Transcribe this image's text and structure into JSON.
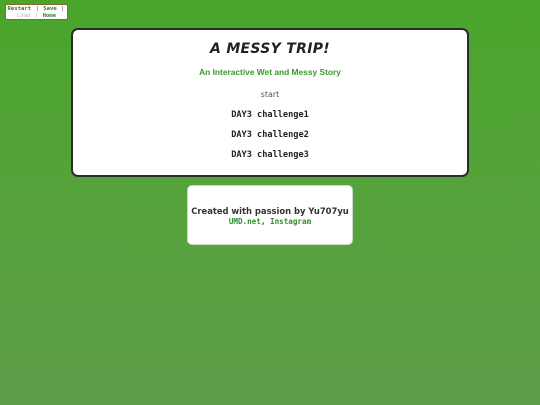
{
  "nav": {
    "restart": "Restart",
    "save": "Save",
    "load": "Load",
    "home": "Home",
    "separator": "|"
  },
  "story": {
    "title": "A MESSY TRIP!",
    "subtitle": "An Interactive Wet and Messy Story",
    "start_label": "start",
    "passages": [
      "DAY3 challenge1",
      "DAY3 challenge2",
      "DAY3 challenge3"
    ]
  },
  "footer": {
    "credit": "Created with passion by Yu707yu",
    "link1": "UMD.net",
    "comma": ",",
    "link2": "Instagram"
  },
  "colors": {
    "accent_green": "#3a9a2a",
    "background_green": "#4aa52b"
  }
}
